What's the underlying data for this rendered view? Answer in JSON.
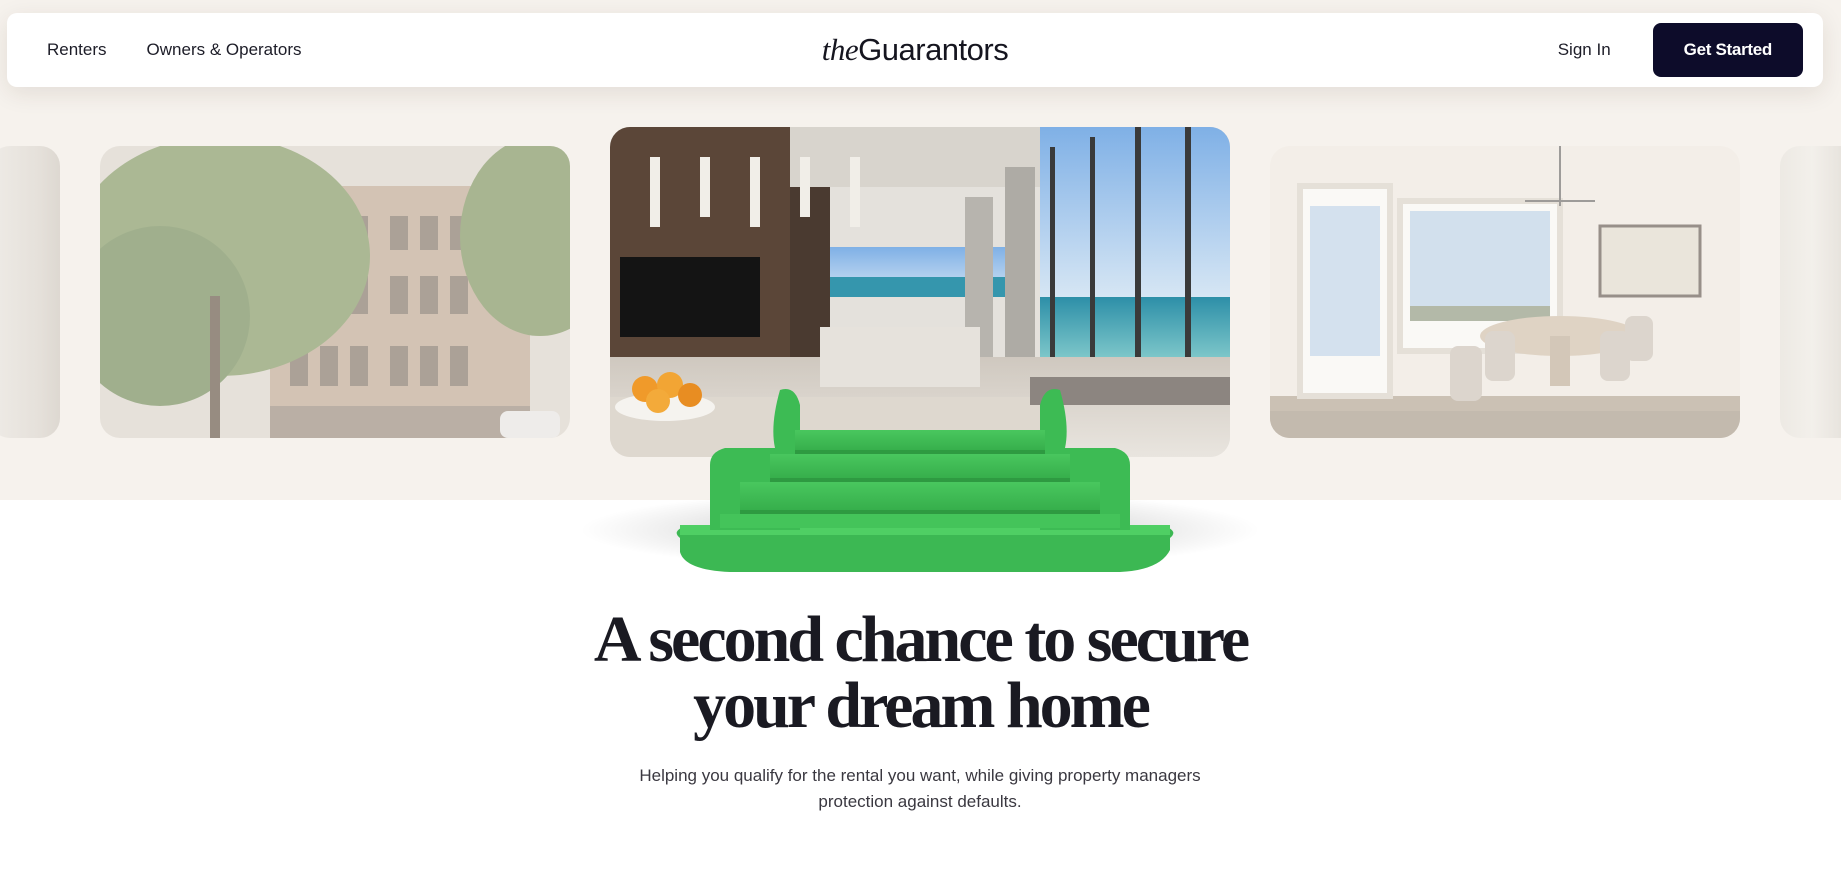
{
  "nav": {
    "left_links": [
      "Renters",
      "Owners & Operators"
    ],
    "logo_the": "the",
    "logo_brand": "Guarantors",
    "sign_in": "Sign In",
    "cta": "Get Started"
  },
  "carousel": {
    "slides": [
      {
        "name": "interior-curtain"
      },
      {
        "name": "brownstone-street"
      },
      {
        "name": "oceanfront-kitchen"
      },
      {
        "name": "dining-room"
      },
      {
        "name": "living-room"
      }
    ],
    "active_index": 2
  },
  "hero": {
    "headline_line1": "A second chance to secure",
    "headline_line2": "your dream home",
    "subtext": "Helping you qualify for the rental you want, while giving property managers protection against defaults."
  },
  "colors": {
    "cta_bg": "#0d0c2a",
    "hero_bg": "#f6f2ed",
    "stairs_green": "#3fbe55"
  },
  "icons": [
    "green-stairs-illustration"
  ]
}
